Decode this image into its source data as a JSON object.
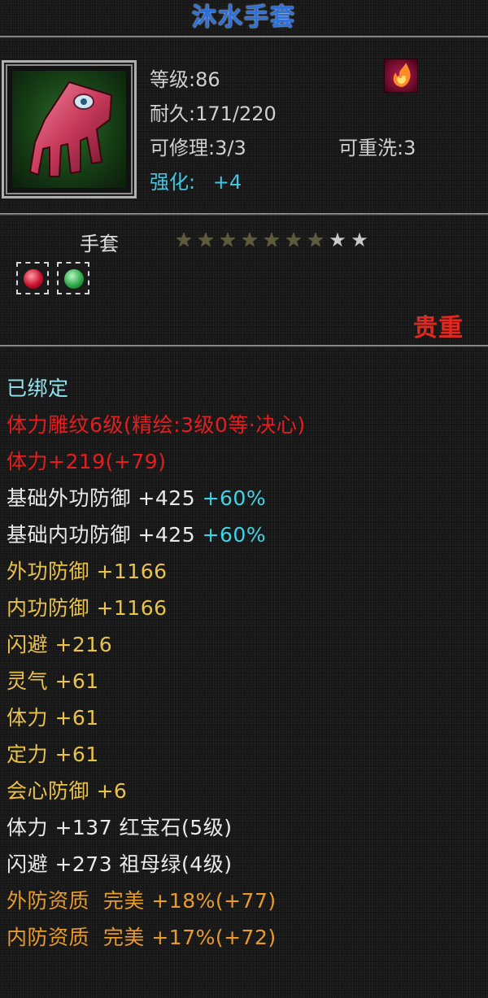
{
  "item": {
    "name": "沐水手套",
    "level": "等级:86",
    "durability": "耐久:171/220",
    "repairable": "可修理:3/3",
    "rewash": "可重洗:3",
    "enhance_label": "强化:",
    "enhance_value": "+4",
    "slot_type": "手套",
    "stars_total": 9,
    "stars_lit": 7,
    "rarity": "贵重"
  },
  "attributes": {
    "bound": "已绑定",
    "engrave": "体力雕纹6级(精绘:3级0等·决心)",
    "engrave_bonus": "体力+219(+79)",
    "base_ext_def": "基础外功防御 +425",
    "base_ext_def_pct": "+60%",
    "base_int_def": "基础内功防御 +425",
    "base_int_def_pct": "+60%",
    "ext_def": "外功防御 +1166",
    "int_def": "内功防御 +1166",
    "dodge": "闪避 +216",
    "spirit": "灵气 +61",
    "stamina": "体力 +61",
    "focus": "定力 +61",
    "crit_def": "会心防御 +6",
    "gem1": "体力 +137 红宝石(5级)",
    "gem2": "闪避 +273 祖母绿(4级)",
    "quality_ext": "外防资质  完美 +18%(+77)",
    "quality_int": "内防资质  完美 +17%(+72)"
  },
  "gems": [
    {
      "name": "ruby-gem-icon",
      "color": "#c8102e"
    },
    {
      "name": "emerald-gem-icon",
      "color": "#2ea84a"
    }
  ],
  "colors": {
    "title": "#2f6fd8",
    "rarity": "#e02a20",
    "attribute_red": "#e41e1e",
    "attribute_gold": "#e8c24a",
    "attribute_orange": "#e89b2a",
    "percent_teal": "#3fd3e6"
  }
}
